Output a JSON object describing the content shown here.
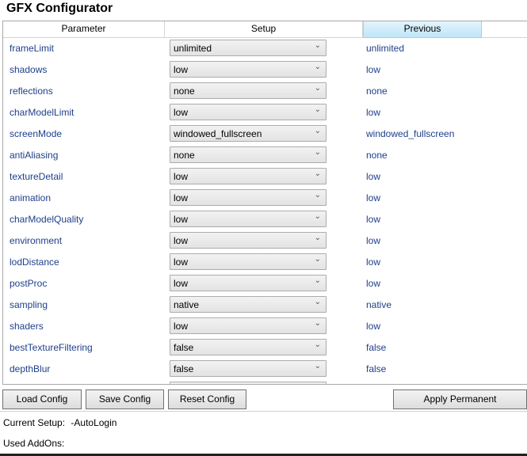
{
  "window": {
    "title": "GFX Configurator"
  },
  "grid": {
    "headers": {
      "parameter": "Parameter",
      "setup": "Setup",
      "previous": "Previous"
    },
    "rows": [
      {
        "name": "frameLimit",
        "setup": "unlimited",
        "previous": "unlimited"
      },
      {
        "name": "shadows",
        "setup": "low",
        "previous": "low"
      },
      {
        "name": "reflections",
        "setup": "none",
        "previous": "none"
      },
      {
        "name": "charModelLimit",
        "setup": "low",
        "previous": "low"
      },
      {
        "name": "screenMode",
        "setup": "windowed_fullscreen",
        "previous": "windowed_fullscreen"
      },
      {
        "name": "antiAliasing",
        "setup": "none",
        "previous": "none"
      },
      {
        "name": "textureDetail",
        "setup": "low",
        "previous": "low"
      },
      {
        "name": "animation",
        "setup": "low",
        "previous": "low"
      },
      {
        "name": "charModelQuality",
        "setup": "low",
        "previous": "low"
      },
      {
        "name": "environment",
        "setup": "low",
        "previous": "low"
      },
      {
        "name": "lodDistance",
        "setup": "low",
        "previous": "low"
      },
      {
        "name": "postProc",
        "setup": "low",
        "previous": "low"
      },
      {
        "name": "sampling",
        "setup": "native",
        "previous": "native"
      },
      {
        "name": "shaders",
        "setup": "low",
        "previous": "low"
      },
      {
        "name": "bestTextureFiltering",
        "setup": "false",
        "previous": "false"
      },
      {
        "name": "depthBlur",
        "setup": "false",
        "previous": "false"
      }
    ]
  },
  "buttons": {
    "load": "Load Config",
    "save": "Save Config",
    "reset": "Reset Config",
    "apply": "Apply Permanent"
  },
  "status": {
    "current_setup_label": "Current Setup:",
    "current_setup_value": "-AutoLogin",
    "used_addons_label": "Used AddOns:"
  },
  "colors": {
    "param_text": "#1e3f8a",
    "selected_header": "#bfe6f8"
  },
  "icons": {
    "dropdown": "chevron-down-icon"
  }
}
